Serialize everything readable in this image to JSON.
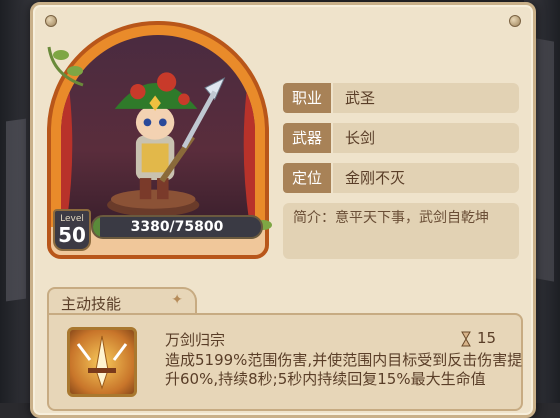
{
  "hero": {
    "level_word": "Level",
    "level": "50",
    "exp_text": "3380/75800",
    "exp_fraction": 0.0446
  },
  "info": [
    {
      "label": "职业",
      "value": "武圣"
    },
    {
      "label": "武器",
      "value": "长剑"
    },
    {
      "label": "定位",
      "value": "金刚不灭"
    }
  ],
  "intro": "简介：意平天下事，武剑自乾坤",
  "skill": {
    "tab_label": "主动技能",
    "tab_icon": "sparkle-icon",
    "name": "万剑归宗",
    "cost_icon": "hourglass-icon",
    "cost": "15",
    "description": "造成5199%范围伤害,并使范围内目标受到反击伤害提升60%,持续8秒;5秒内持续回复15%最大生命值"
  },
  "colors": {
    "panel_bg": "#efe3cb",
    "label_bg": "#a88257",
    "value_bg": "#e2d2b4",
    "frame_orange": "#e98b2a"
  }
}
